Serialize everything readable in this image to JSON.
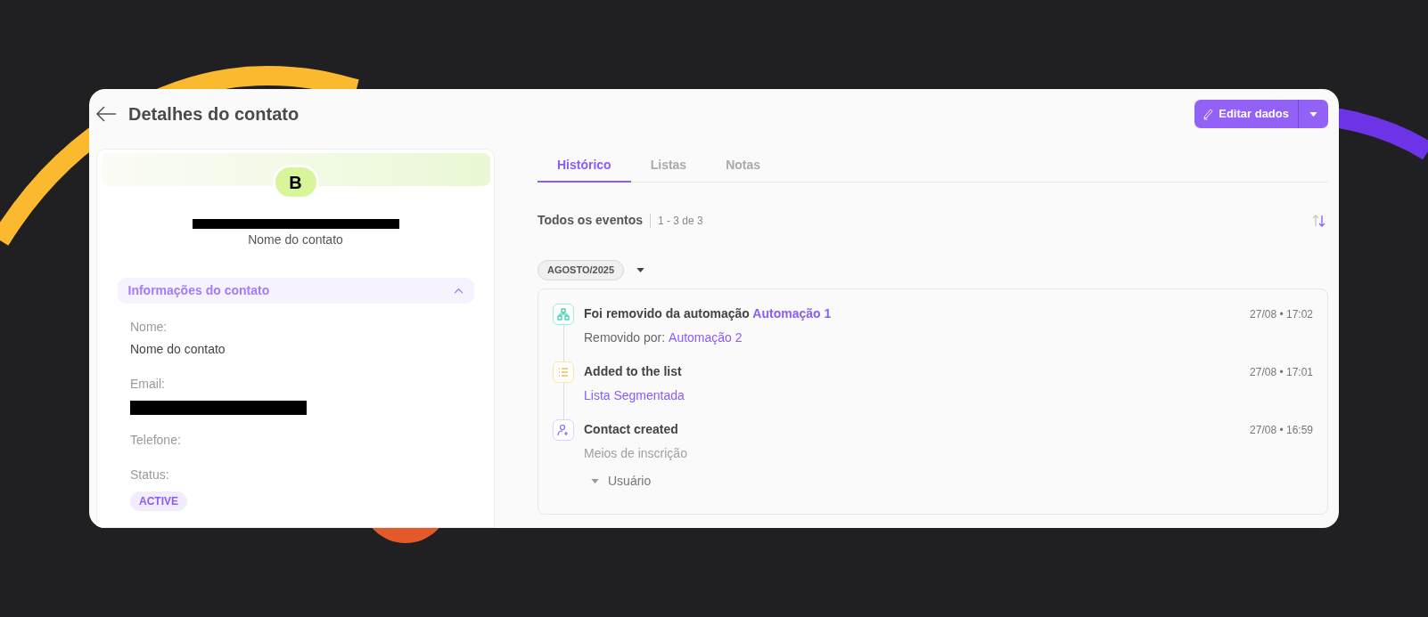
{
  "header": {
    "title": "Detalhes do contato",
    "edit_button": "Editar dados"
  },
  "contact": {
    "avatar_initial": "B",
    "name_caption": "Nome do contato"
  },
  "accordion": {
    "title": "Informações do contato",
    "expanded": true
  },
  "fields": [
    {
      "kind": "text",
      "label": "Nome:",
      "value": "Nome do contato"
    },
    {
      "kind": "redacted",
      "label": "Email:"
    },
    {
      "kind": "empty",
      "label": "Telefone:"
    },
    {
      "kind": "badge",
      "label": "Status:",
      "value": "ACTIVE"
    }
  ],
  "tabs": [
    {
      "label": "Histórico",
      "selected": true
    },
    {
      "label": "Listas",
      "selected": false
    },
    {
      "label": "Notas",
      "selected": false
    }
  ],
  "events_header": {
    "title": "Todos os eventos",
    "count": "1 - 3 de 3"
  },
  "month_filter": "AGOSTO/2025",
  "events": [
    {
      "kind": "automation",
      "title": "Foi removido da automação",
      "title_link": "Automação 1",
      "time": "27/08 • 17:02",
      "detail_label": "Removido por:",
      "detail_link": "Automação 2"
    },
    {
      "kind": "list",
      "title": "Added to the list",
      "time": "27/08 • 17:01",
      "detail_link": "Lista Segmentada"
    },
    {
      "kind": "contact",
      "title": "Contact created",
      "time": "27/08 • 16:59",
      "detail_label": "Meios de inscrição",
      "sub_items": [
        "Usuário"
      ]
    }
  ]
}
